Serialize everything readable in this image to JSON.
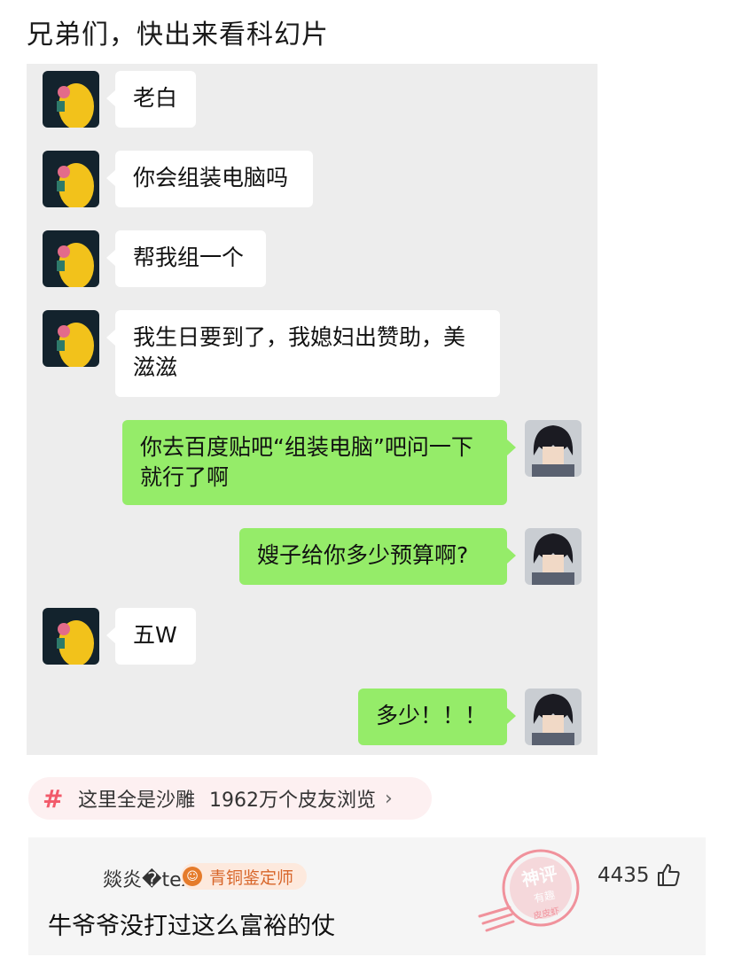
{
  "post": {
    "title": "兄弟们，快出来看科幻片"
  },
  "chat": {
    "messages": [
      {
        "side": "in",
        "text": "老白"
      },
      {
        "side": "in",
        "text": "你会组装电脑吗"
      },
      {
        "side": "in",
        "text": "帮我组一个"
      },
      {
        "side": "in",
        "text": "我生日要到了，我媳妇出赞助，美滋滋"
      },
      {
        "side": "out",
        "text": "你去百度贴吧“组装电脑”吧问一下就行了啊"
      },
      {
        "side": "out",
        "text": "嫂子给你多少预算啊?"
      },
      {
        "side": "in",
        "text": "五W"
      },
      {
        "side": "out",
        "text": "多少！！！"
      }
    ]
  },
  "topic": {
    "icon": "hash-icon",
    "name": "这里全是沙雕",
    "views": "1962万个皮友浏览",
    "chevron": "›"
  },
  "comment": {
    "username": "燚炎�textile",
    "badge": "青铜鉴定师",
    "text": "牛爷爷没打过这么富裕的仗",
    "likes": "4435"
  },
  "stamp": {
    "line1": "神评",
    "line2": "有趣",
    "line3": "皮皮虾"
  },
  "colors": {
    "bubble_out": "#95ec69",
    "bubble_in": "#ffffff",
    "chat_bg": "#ededed",
    "topic_hash": "#f25a6a",
    "badge_text": "#d8662a",
    "stamp": "#f07a86"
  }
}
